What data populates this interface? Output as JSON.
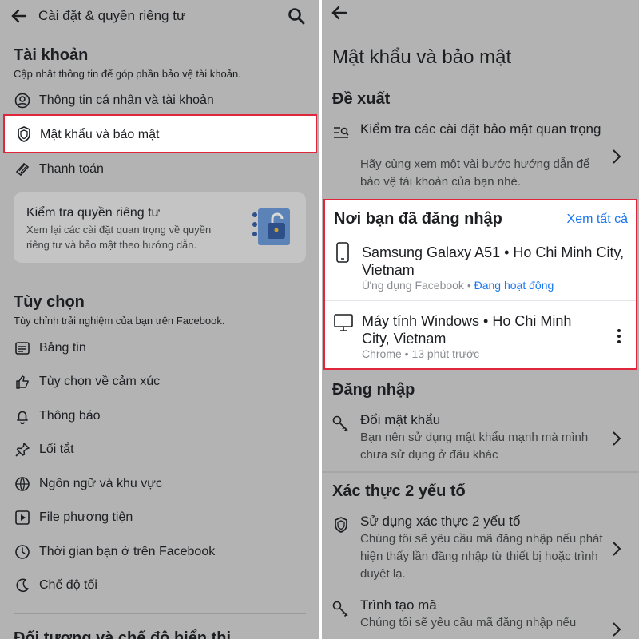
{
  "left": {
    "header": {
      "title": "Cài đặt & quyền riêng tư"
    },
    "account": {
      "title": "Tài khoản",
      "subtitle": "Cập nhật thông tin để góp phần bảo vệ tài khoản.",
      "items": [
        {
          "label": "Thông tin cá nhân và tài khoản",
          "icon": "person-circle-icon"
        },
        {
          "label": "Mật khẩu và bảo mật",
          "icon": "shield-icon"
        },
        {
          "label": "Thanh toán",
          "icon": "tag-icon"
        }
      ]
    },
    "privacy_card": {
      "title": "Kiểm tra quyền riêng tư",
      "text": "Xem lại các cài đặt quan trọng về quyền riêng tư và bảo mật theo hướng dẫn.",
      "icon": "privacy-lock-illustration"
    },
    "preferences": {
      "title": "Tùy chọn",
      "subtitle": "Tùy chỉnh trải nghiệm của bạn trên Facebook.",
      "items": [
        {
          "label": "Bảng tin",
          "icon": "news-feed-icon"
        },
        {
          "label": "Tùy chọn về cảm xúc",
          "icon": "reaction-icon"
        },
        {
          "label": "Thông báo",
          "icon": "bell-icon"
        },
        {
          "label": "Lối tắt",
          "icon": "pin-icon"
        },
        {
          "label": "Ngôn ngữ và khu vực",
          "icon": "globe-icon"
        },
        {
          "label": "File phương tiện",
          "icon": "media-icon"
        },
        {
          "label": "Thời gian bạn ở trên Facebook",
          "icon": "clock-icon"
        },
        {
          "label": "Chế độ tối",
          "icon": "moon-icon"
        }
      ]
    },
    "next_section_partial": "Đối tượng và chế độ hiển thị"
  },
  "right": {
    "title": "Mật khẩu và bảo mật",
    "suggestion": {
      "title": "Đề xuất",
      "item_title": "Kiểm tra các cài đặt bảo mật quan trọng",
      "item_sub": "Hãy cùng xem một vài bước hướng dẫn để bảo vệ tài khoản của bạn nhé."
    },
    "logins": {
      "title": "Nơi bạn đã đăng nhập",
      "see_all": "Xem tất cả",
      "devices": [
        {
          "name": "Samsung Galaxy A51 • Ho Chi Minh City, Vietnam",
          "app": "Ứng dụng Facebook • ",
          "status": "Đang hoạt động",
          "icon": "phone-icon"
        },
        {
          "name": "Máy tính Windows • Ho Chi Minh City, Vietnam",
          "app": "Chrome • 13 phút trước",
          "status": "",
          "icon": "desktop-icon"
        }
      ]
    },
    "login": {
      "title": "Đăng nhập",
      "item_title": "Đổi mật khẩu",
      "item_sub": "Bạn nên sử dụng mật khẩu mạnh mà mình chưa sử dụng ở đâu khác"
    },
    "two_factor": {
      "title": "Xác thực 2 yếu tố",
      "item_title": "Sử dụng xác thực 2 yếu tố",
      "item_sub": "Chúng tôi sẽ yêu cầu mã đăng nhập nếu phát hiện thấy lần đăng nhập từ thiết bị hoặc trình duyệt lạ.",
      "code_title": "Trình tạo mã",
      "code_sub": "Chúng tôi sẽ yêu cầu mã đăng nhập nếu"
    }
  },
  "colors": {
    "highlight_border": "#e0263b",
    "link_blue": "#1877f2",
    "dim_overlay": "#b3b3b3"
  }
}
